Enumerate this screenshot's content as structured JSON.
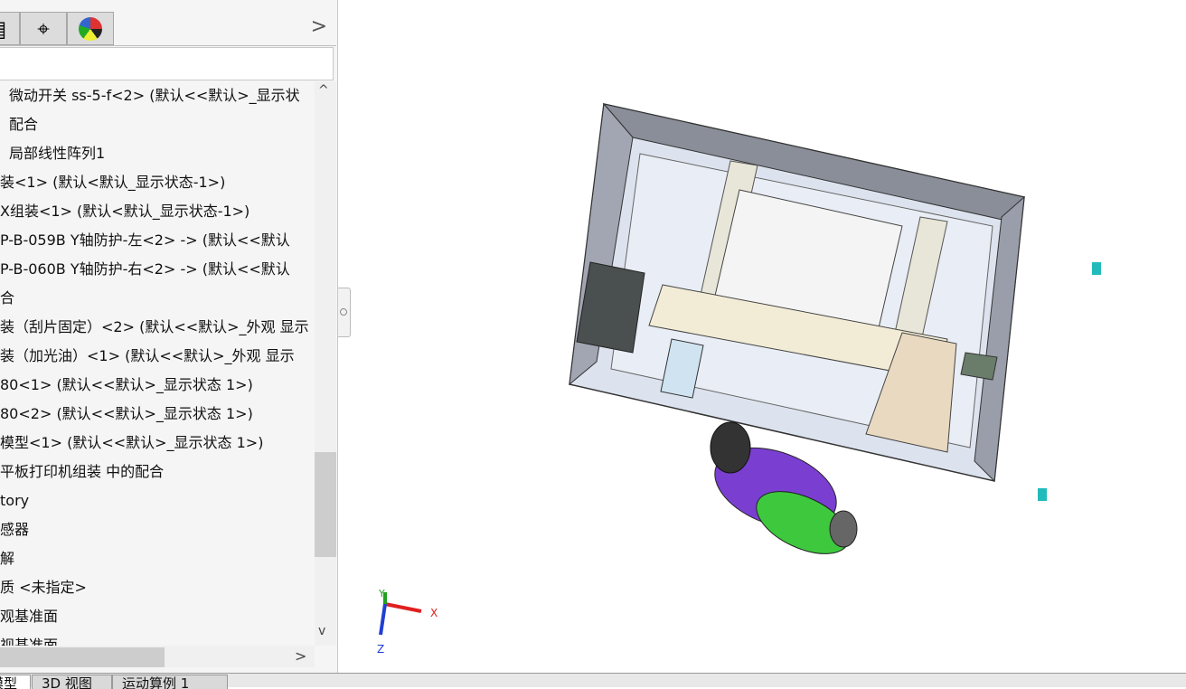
{
  "panel": {
    "tabs": [
      {
        "icon": "property-manager-icon"
      },
      {
        "icon": "crosshair-icon"
      },
      {
        "icon": "appearance-ball-icon"
      }
    ],
    "more_label": ">",
    "filter_value": "",
    "tree_items": [
      "微动开关 ss-5-f<2> (默认<<默认>_显示状",
      "配合",
      "局部线性阵列1",
      "装<1> (默认<默认_显示状态-1>)",
      "X组装<1> (默认<默认_显示状态-1>)",
      "P-B-059B Y轴防护-左<2> -> (默认<<默认",
      "P-B-060B Y轴防护-右<2> -> (默认<<默认",
      "合",
      "装（刮片固定）<2> (默认<<默认>_外观 显示",
      "装（加光油）<1> (默认<<默认>_外观 显示",
      "80<1> (默认<<默认>_显示状态 1>)",
      "80<2> (默认<<默认>_显示状态 1>)",
      "模型<1> (默认<<默认>_显示状态 1>)",
      "平板打印机组装 中的配合",
      "tory",
      "感器",
      "解",
      "质 <未指定>",
      "观基准面",
      "视基准面"
    ],
    "scroll_up": "^",
    "scroll_down": "v",
    "scroll_right": ">"
  },
  "bottom_tabs": [
    "模型",
    "3D 视图",
    "运动算例 1"
  ],
  "triad": {
    "x": "X",
    "y": "Y",
    "z": "Z"
  },
  "colors": {
    "x_axis": "#e02020",
    "y_axis": "#20a020",
    "z_axis": "#2040d0",
    "figure_suit": "#7a3fd0",
    "figure_legs": "#3ec83e"
  }
}
